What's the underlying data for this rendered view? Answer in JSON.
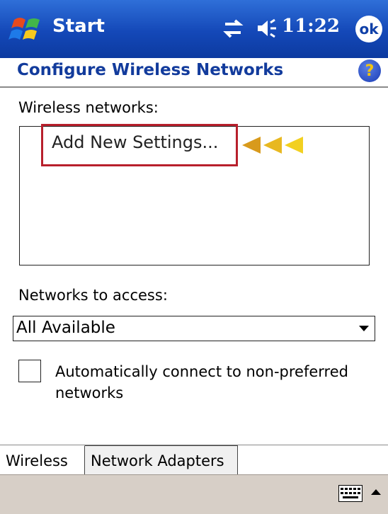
{
  "titlebar": {
    "app_label": "Start",
    "time": "11:22",
    "ok_label": "ok",
    "icons": [
      "windows-flag-icon",
      "connectivity-icon",
      "volume-icon"
    ]
  },
  "header": {
    "title": "Configure Wireless Networks",
    "help_glyph": "?"
  },
  "wireless": {
    "label": "Wireless networks:",
    "list_items": [
      "Add New Settings..."
    ]
  },
  "access": {
    "label": "Networks to access:",
    "selected": "All Available"
  },
  "auto_connect": {
    "label": "Automatically connect to non-preferred networks",
    "checked": false
  },
  "tabs": [
    {
      "label": "Wireless",
      "active": true
    },
    {
      "label": "Network Adapters",
      "active": false
    }
  ],
  "colors": {
    "titlebar": "#1448b8",
    "title_text": "#123b9c",
    "highlight": "#b8202c",
    "arrow_dark": "#d89a1c",
    "arrow_light": "#f2d020",
    "command_bar": "#d7cfc7"
  }
}
